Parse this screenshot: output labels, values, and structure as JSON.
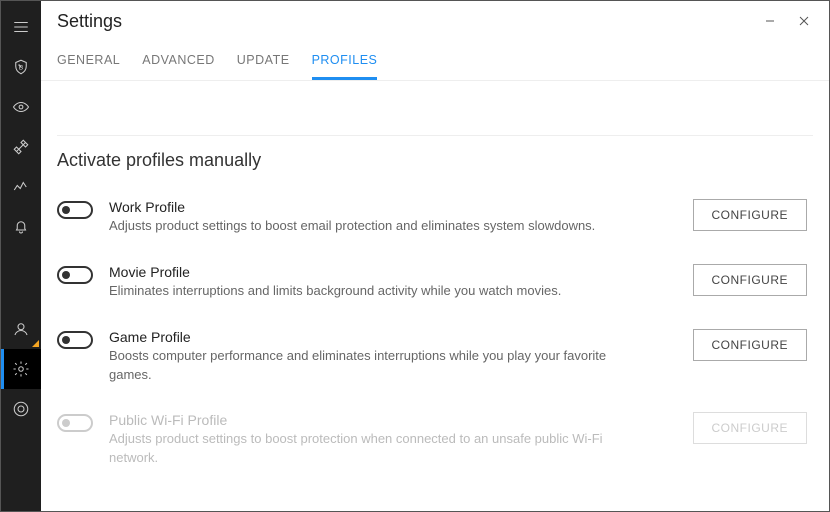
{
  "window": {
    "title": "Settings"
  },
  "tabs": {
    "general": "GENERAL",
    "advanced": "ADVANCED",
    "update": "UPDATE",
    "profiles": "PROFILES"
  },
  "section": {
    "title": "Activate profiles manually"
  },
  "buttons": {
    "configure": "CONFIGURE"
  },
  "profiles": {
    "work": {
      "name": "Work Profile",
      "desc": "Adjusts product settings to boost email protection and eliminates system slowdowns."
    },
    "movie": {
      "name": "Movie Profile",
      "desc": "Eliminates interruptions and limits background activity while you watch movies."
    },
    "game": {
      "name": "Game Profile",
      "desc": "Boosts computer performance and eliminates interruptions while you play your favorite games."
    },
    "wifi": {
      "name": "Public Wi-Fi Profile",
      "desc": "Adjusts product settings to boost protection when connected to an unsafe public Wi-Fi network."
    }
  }
}
